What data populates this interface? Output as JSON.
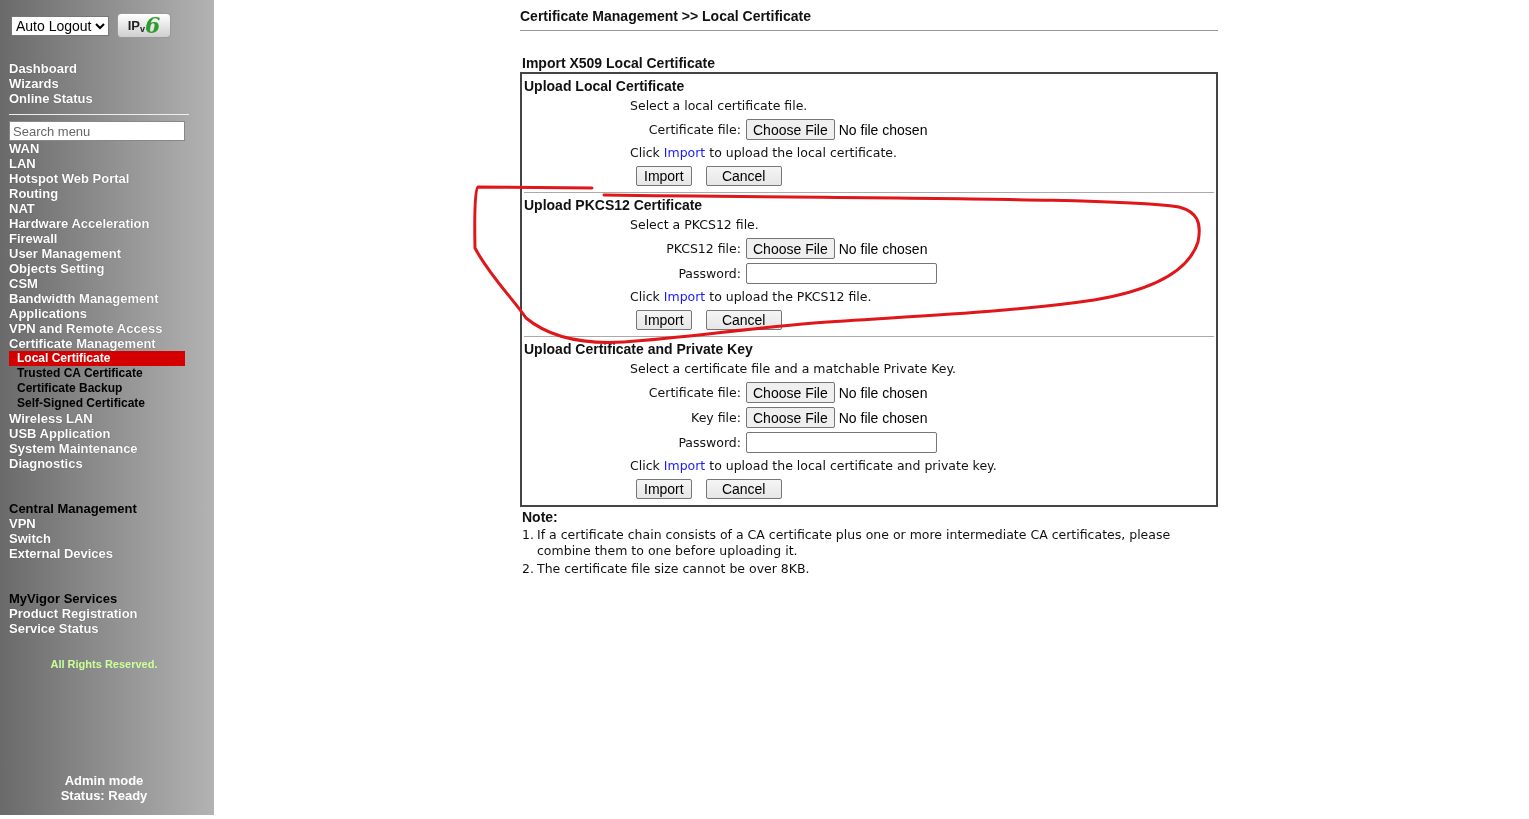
{
  "sidebar": {
    "auto_logout": "Auto Logout",
    "ipv6_logo": {
      "main": "IP",
      "sub": "v",
      "digit": "6"
    },
    "quick_links": [
      {
        "label": "Dashboard",
        "selected": false
      },
      {
        "label": "Wizards",
        "selected": false
      },
      {
        "label": "Online Status",
        "selected": false
      }
    ],
    "search": {
      "placeholder": "Search menu"
    },
    "menu": [
      {
        "label": "WAN",
        "selected": false
      },
      {
        "label": "LAN",
        "selected": false
      },
      {
        "label": "Hotspot Web Portal",
        "selected": false
      },
      {
        "label": "Routing",
        "selected": false
      },
      {
        "label": "NAT",
        "selected": false
      },
      {
        "label": "Hardware Acceleration",
        "selected": false
      },
      {
        "label": "Firewall",
        "selected": false
      },
      {
        "label": "User Management",
        "selected": false
      },
      {
        "label": "Objects Setting",
        "selected": false
      },
      {
        "label": "CSM",
        "selected": false
      },
      {
        "label": "Bandwidth Management",
        "selected": false
      },
      {
        "label": "Applications",
        "selected": false
      },
      {
        "label": "VPN and Remote Access",
        "selected": false
      },
      {
        "label": "Certificate Management",
        "selected": false,
        "children": [
          {
            "label": "Local Certificate",
            "selected": true
          },
          {
            "label": "Trusted CA Certificate",
            "selected": false
          },
          {
            "label": "Certificate Backup",
            "selected": false
          },
          {
            "label": "Self-Signed Certificate",
            "selected": false
          }
        ]
      },
      {
        "label": "Wireless LAN",
        "selected": false
      },
      {
        "label": "USB Application",
        "selected": false
      },
      {
        "label": "System Maintenance",
        "selected": false
      },
      {
        "label": "Diagnostics",
        "selected": false
      }
    ],
    "groups": [
      {
        "title": "Central Management",
        "items": [
          {
            "label": "VPN",
            "selected": false
          },
          {
            "label": "Switch",
            "selected": false
          },
          {
            "label": "External Devices",
            "selected": false
          }
        ]
      },
      {
        "title": "MyVigor Services",
        "items": [
          {
            "label": "Product Registration",
            "selected": false
          },
          {
            "label": "Service Status",
            "selected": false
          }
        ]
      }
    ],
    "copyright": "All Rights Reserved.",
    "mode": "Admin mode",
    "status": "Status: Ready"
  },
  "main": {
    "breadcrumb": "Certificate Management >> Local Certificate",
    "title": "Import X509 Local Certificate",
    "sections": [
      {
        "title": "Upload Local Certificate",
        "description": "Select a local certificate file.",
        "fields": [
          {
            "kind": "file",
            "label": "Certificate file:",
            "button": "Choose File",
            "value": "No file chosen"
          }
        ],
        "instruction": {
          "before": "Click",
          "link": "Import",
          "after": "to upload the local certificate."
        },
        "buttons": [
          "Import",
          "Cancel"
        ]
      },
      {
        "title": "Upload PKCS12 Certificate",
        "description": "Select a PKCS12 file.",
        "fields": [
          {
            "kind": "file",
            "label": "PKCS12 file:",
            "button": "Choose File",
            "value": "No file chosen"
          },
          {
            "kind": "password",
            "label": "Password:"
          }
        ],
        "instruction": {
          "before": "Click",
          "link": "Import",
          "after": "to upload the PKCS12 file."
        },
        "buttons": [
          "Import",
          "Cancel"
        ]
      },
      {
        "title": "Upload Certificate and Private Key",
        "description": "Select a certificate file and a matchable Private Key.",
        "fields": [
          {
            "kind": "file",
            "label": "Certificate file:",
            "button": "Choose File",
            "value": "No file chosen"
          },
          {
            "kind": "file",
            "label": "Key file:",
            "button": "Choose File",
            "value": "No file chosen"
          },
          {
            "kind": "password",
            "label": "Password:"
          }
        ],
        "instruction": {
          "before": "Click",
          "link": "Import",
          "after": "to upload the local certificate and private key."
        },
        "buttons": [
          "Import",
          "Cancel"
        ]
      }
    ],
    "note": {
      "title": "Note:",
      "items": [
        {
          "number": "1.",
          "text": "If a certificate chain consists of a CA certificate plus one or more intermediate CA certificates, please combine them to one before uploading it."
        },
        {
          "number": "2.",
          "text": "The certificate file size cannot be over 8KB."
        }
      ]
    }
  }
}
